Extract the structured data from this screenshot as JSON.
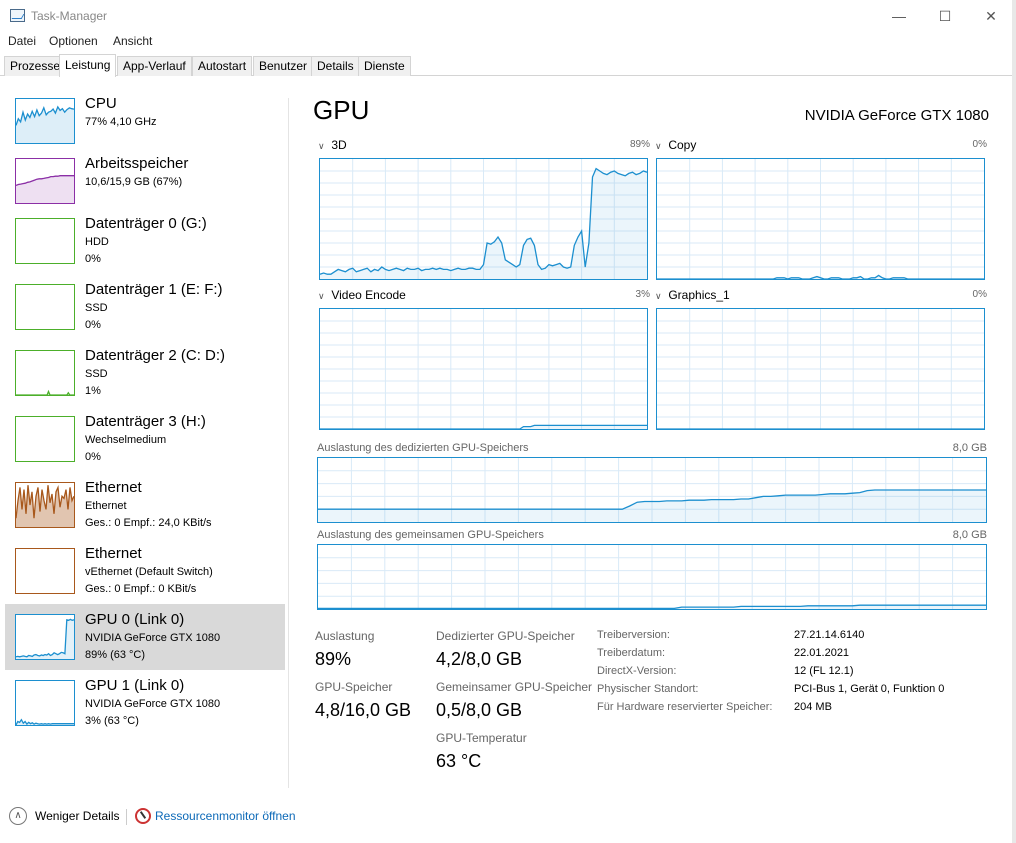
{
  "window": {
    "title": "Task-Manager",
    "minimize_glyph": "—",
    "maximize_glyph": "☐",
    "close_glyph": "✕"
  },
  "menu": [
    "Datei",
    "Optionen",
    "Ansicht"
  ],
  "tabs": [
    "Prozesse",
    "Leistung",
    "App-Verlauf",
    "Autostart",
    "Benutzer",
    "Details",
    "Dienste"
  ],
  "active_tab": "Leistung",
  "sidebar": {
    "items": [
      {
        "name": "CPU",
        "line1": "77% 4,10 GHz",
        "line2": "",
        "color": "#1c8fcf"
      },
      {
        "name": "Arbeitsspeicher",
        "line1": "10,6/15,9 GB (67%)",
        "line2": "",
        "color": "#8b2fa6"
      },
      {
        "name": "Datenträger 0 (G:)",
        "line1": "HDD",
        "line2": "0%",
        "color": "#4caf2a"
      },
      {
        "name": "Datenträger 1 (E: F:)",
        "line1": "SSD",
        "line2": "0%",
        "color": "#4caf2a"
      },
      {
        "name": "Datenträger 2 (C: D:)",
        "line1": "SSD",
        "line2": "1%",
        "color": "#4caf2a"
      },
      {
        "name": "Datenträger 3 (H:)",
        "line1": "Wechselmedium",
        "line2": "0%",
        "color": "#4caf2a"
      },
      {
        "name": "Ethernet",
        "line1": "Ethernet",
        "line2": "Ges.: 0 Empf.: 24,0 KBit/s",
        "color": "#a8581c"
      },
      {
        "name": "Ethernet",
        "line1": "vEthernet (Default Switch)",
        "line2": "Ges.: 0 Empf.: 0 KBit/s",
        "color": "#a8581c"
      },
      {
        "name": "GPU 0 (Link 0)",
        "line1": "NVIDIA GeForce GTX 1080",
        "line2": "89% (63 °C)",
        "color": "#1c8fcf"
      },
      {
        "name": "GPU 1 (Link 0)",
        "line1": "NVIDIA GeForce GTX 1080",
        "line2": "3% (63 °C)",
        "color": "#1c8fcf"
      }
    ],
    "selected_index": 8
  },
  "main": {
    "title": "GPU",
    "model": "NVIDIA GeForce GTX 1080",
    "engines": [
      {
        "label": "3D",
        "percent": "89%"
      },
      {
        "label": "Copy",
        "percent": "0%"
      },
      {
        "label": "Video Encode",
        "percent": "3%"
      },
      {
        "label": "Graphics_1",
        "percent": "0%"
      }
    ],
    "dedicated_label": "Auslastung des dedizierten GPU-Speichers",
    "dedicated_max": "8,0 GB",
    "shared_label": "Auslastung des gemeinsamen GPU-Speichers",
    "shared_max": "8,0 GB",
    "stats": {
      "auslastung_label": "Auslastung",
      "auslastung_value": "89%",
      "gpu_speicher_label": "GPU-Speicher",
      "gpu_speicher_value": "4,8/16,0 GB",
      "dediziert_label": "Dedizierter GPU-Speicher",
      "dediziert_value": "4,2/8,0 GB",
      "gemeinsam_label": "Gemeinsamer GPU-Speicher",
      "gemeinsam_value": "0,5/8,0 GB",
      "temp_label": "GPU-Temperatur",
      "temp_value": "63 °C"
    },
    "info": [
      {
        "label": "Treiberversion:",
        "value": "27.21.14.6140"
      },
      {
        "label": "Treiberdatum:",
        "value": "22.01.2021"
      },
      {
        "label": "DirectX-Version:",
        "value": "12 (FL 12.1)"
      },
      {
        "label": "Physischer Standort:",
        "value": "PCI-Bus 1, Gerät 0, Funktion 0"
      },
      {
        "label": "Für Hardware reservierter Speicher:",
        "value": "204 MB"
      }
    ]
  },
  "footer": {
    "less_details": "Weniger Details",
    "resource_monitor": "Ressourcenmonitor öffnen"
  },
  "series": {
    "gpu_3d": [
      4,
      5,
      4,
      4,
      6,
      8,
      7,
      6,
      8,
      9,
      6,
      7,
      8,
      9,
      6,
      8,
      7,
      10,
      8,
      7,
      8,
      9,
      8,
      7,
      9,
      8,
      8,
      9,
      7,
      8,
      8,
      9,
      8,
      9,
      8,
      8,
      7,
      8,
      9,
      8,
      8,
      9,
      9,
      8,
      8,
      12,
      30,
      29,
      31,
      35,
      30,
      16,
      14,
      12,
      10,
      12,
      28,
      33,
      34,
      28,
      12,
      8,
      9,
      12,
      11,
      12,
      13,
      10,
      9,
      10,
      28,
      35,
      40,
      10,
      30,
      85,
      92,
      90,
      88,
      87,
      89,
      90,
      88,
      87,
      86,
      88,
      89,
      87,
      88,
      90,
      89
    ],
    "gpu_copy": [
      0,
      0,
      0,
      0,
      0,
      0,
      0,
      0,
      0,
      0,
      0,
      0,
      0,
      0,
      0,
      0,
      0,
      0,
      0,
      0,
      0,
      0,
      0,
      0,
      0,
      0,
      0,
      0,
      0,
      0,
      0,
      0,
      0,
      1,
      1,
      1,
      0,
      1,
      1,
      1,
      0,
      0,
      0,
      1,
      2,
      1,
      0,
      0,
      1,
      1,
      1,
      0,
      0,
      0,
      1,
      1,
      2,
      0,
      0,
      1,
      1,
      3,
      1,
      0,
      0,
      1,
      1,
      1,
      1,
      0,
      0,
      0,
      0,
      0,
      0,
      0,
      0,
      0,
      0,
      0,
      0,
      0,
      0,
      0,
      0,
      0,
      0,
      0,
      0,
      0,
      0
    ],
    "gpu_encode": [
      0,
      0,
      0,
      0,
      0,
      0,
      0,
      0,
      0,
      0,
      0,
      0,
      0,
      0,
      0,
      0,
      0,
      0,
      0,
      0,
      0,
      0,
      0,
      0,
      0,
      0,
      0,
      0,
      0,
      0,
      0,
      0,
      0,
      0,
      0,
      0,
      0,
      0,
      0,
      0,
      0,
      0,
      0,
      0,
      0,
      0,
      0,
      0,
      0,
      0,
      0,
      0,
      0,
      0,
      0,
      0,
      2,
      2,
      2,
      3,
      3,
      3,
      3,
      3,
      3,
      3,
      3,
      3,
      3,
      3,
      3,
      3,
      3,
      3,
      3,
      3,
      3,
      3,
      3,
      3,
      3,
      3,
      3,
      3,
      3,
      3,
      3,
      3,
      3,
      3,
      3
    ],
    "gpu_graphics1": [
      0,
      0,
      0,
      0,
      0,
      0,
      0,
      0,
      0,
      0,
      0,
      0,
      0,
      0,
      0,
      0,
      0,
      0,
      0,
      0,
      0,
      0,
      0,
      0,
      0,
      0,
      0,
      0,
      0,
      0,
      0,
      0,
      0,
      0,
      0,
      0,
      0,
      0,
      0,
      0,
      0,
      0,
      0,
      0,
      0,
      0,
      0,
      0,
      0,
      0,
      0,
      0,
      0,
      0,
      0,
      0,
      0,
      0,
      0,
      0,
      0,
      0,
      0,
      0,
      0,
      0,
      0,
      0,
      0,
      0,
      0,
      0,
      0,
      0,
      0,
      0,
      0,
      0,
      0,
      0,
      0,
      0,
      0,
      0,
      0,
      0,
      0,
      0,
      0,
      0,
      0
    ],
    "dedicated_mem": [
      20,
      20,
      20,
      20,
      20,
      20,
      20,
      20,
      20,
      20,
      20,
      20,
      20,
      20,
      20,
      20,
      20,
      20,
      20,
      20,
      20,
      20,
      20,
      20,
      20,
      20,
      20,
      20,
      20,
      20,
      20,
      20,
      20,
      20,
      20,
      20,
      20,
      20,
      20,
      20,
      20,
      20,
      25,
      31,
      32,
      32,
      32,
      33,
      33,
      33,
      34,
      34,
      34,
      35,
      35,
      35,
      35,
      36,
      36,
      38,
      40,
      40,
      41,
      42,
      42,
      42,
      42,
      42,
      43,
      44,
      44,
      44,
      45,
      46,
      49,
      50,
      50,
      50,
      50,
      50,
      50,
      50,
      50,
      50,
      50,
      50,
      50,
      50,
      50,
      50,
      50
    ],
    "shared_mem": [
      1,
      1,
      1,
      1,
      1,
      1,
      1,
      1,
      1,
      1,
      1,
      1,
      1,
      1,
      1,
      1,
      1,
      1,
      1,
      1,
      1,
      1,
      1,
      1,
      1,
      1,
      1,
      1,
      1,
      1,
      1,
      1,
      1,
      1,
      1,
      1,
      1,
      1,
      1,
      1,
      1,
      1,
      1,
      1,
      1,
      1,
      1,
      1,
      1,
      3,
      3,
      3,
      3,
      3,
      3,
      3,
      3,
      4,
      4,
      4,
      4,
      4,
      4,
      4,
      4,
      4,
      5,
      5,
      5,
      5,
      5,
      5,
      5,
      6,
      6,
      6,
      6,
      6,
      6,
      6,
      6,
      6,
      6,
      6,
      6,
      6,
      6,
      6,
      6,
      6,
      6
    ],
    "cpu": [
      40,
      55,
      48,
      70,
      52,
      66,
      58,
      72,
      60,
      75,
      62,
      68,
      80,
      64,
      70,
      72,
      77,
      68,
      82,
      74,
      78,
      70,
      76,
      80,
      78,
      77
    ],
    "ram": [
      40,
      42,
      43,
      44,
      45,
      47,
      48,
      50,
      52,
      54,
      55,
      55,
      56,
      57,
      58,
      60,
      60,
      61,
      61,
      62,
      62,
      62,
      62,
      62,
      62,
      62
    ],
    "disk2": [
      0,
      0,
      0,
      0,
      0,
      0,
      0,
      0,
      0,
      0,
      0,
      0,
      0,
      0,
      0,
      0,
      0,
      0,
      0,
      0,
      0,
      0,
      0,
      8,
      0,
      0,
      0,
      0,
      0,
      0,
      0,
      0,
      0,
      0,
      0,
      0,
      0,
      5,
      0,
      0,
      0,
      0
    ],
    "eth": [
      20,
      60,
      90,
      40,
      85,
      30,
      95,
      50,
      80,
      20,
      70,
      90,
      35,
      85,
      60,
      40,
      95,
      55,
      75,
      30,
      80,
      90,
      45,
      70,
      65,
      85,
      40,
      90,
      60,
      70
    ],
    "gpu0_thumb": [
      5,
      6,
      5,
      6,
      7,
      6,
      5,
      8,
      7,
      6,
      9,
      10,
      8,
      7,
      9,
      8,
      10,
      9,
      12,
      8,
      10,
      14,
      12,
      10,
      12,
      15,
      14,
      12,
      89,
      88,
      90,
      88,
      89
    ],
    "gpu1_thumb": [
      0,
      8,
      6,
      12,
      4,
      8,
      2,
      6,
      3,
      5,
      2,
      4,
      3,
      2,
      3,
      2,
      3,
      2,
      3,
      2,
      3,
      3,
      3,
      3,
      3,
      3,
      3,
      3,
      3,
      3,
      3,
      3,
      3
    ]
  }
}
